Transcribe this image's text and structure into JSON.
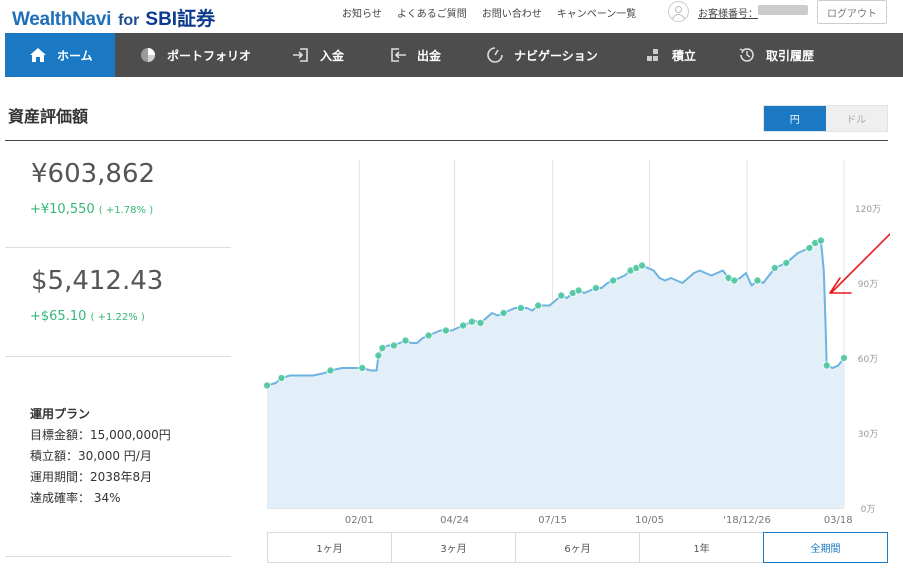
{
  "brand": {
    "name": "WealthNavi",
    "for": "for",
    "partner": "SBI証券"
  },
  "top_links": [
    "お知らせ",
    "よくあるご質問",
    "お問い合わせ",
    "キャンペーン一覧"
  ],
  "account_label": "お客様番号：",
  "logout_label": "ログアウト",
  "nav": [
    {
      "label": "ホーム",
      "icon": "home-icon",
      "active": true
    },
    {
      "label": "ポートフォリオ",
      "icon": "pie-chart-icon",
      "active": false
    },
    {
      "label": "入金",
      "icon": "deposit-icon",
      "active": false
    },
    {
      "label": "出金",
      "icon": "withdraw-icon",
      "active": false
    },
    {
      "label": "ナビゲーション",
      "icon": "gauge-icon",
      "active": false
    },
    {
      "label": "積立",
      "icon": "blocks-icon",
      "active": false
    },
    {
      "label": "取引履歴",
      "icon": "history-icon",
      "active": false
    }
  ],
  "section_title": "資産評価額",
  "currency_toggle": {
    "yen": "円",
    "dollar": "ドル",
    "selected": "円"
  },
  "jpy": {
    "value": "¥603,862",
    "change": "+¥10,550",
    "pct": "( +1.78% )"
  },
  "usd": {
    "value": "$5,412.43",
    "change": "+$65.10",
    "pct": "( +1.22% )"
  },
  "plan": {
    "title": "運用プラン",
    "target": "目標金額：15,000,000円",
    "monthly": "積立額：30,000 円/月",
    "term": "運用期間：2038年8月",
    "probability": "達成確率： 34%"
  },
  "periods": [
    "1ヶ月",
    "3ヶ月",
    "6ヶ月",
    "1年",
    "全期間"
  ],
  "active_period": "全期間",
  "chart_data": {
    "type": "area",
    "x_tick_labels": [
      "02/01",
      "04/24",
      "07/15",
      "10/05",
      "'18/12/26",
      "03/18"
    ],
    "y_tick_labels": [
      "0万",
      "30万",
      "60万",
      "90万",
      "120万"
    ],
    "ylim": [
      0,
      120
    ],
    "y_unit": "万円",
    "x_range": [
      0,
      100
    ],
    "x_ticks_pos": [
      16,
      32.5,
      49.5,
      66.3,
      83.2,
      99
    ],
    "series": [
      {
        "values": [
          [
            0,
            49
          ],
          [
            1.5,
            50
          ],
          [
            2.5,
            52
          ],
          [
            4,
            53
          ],
          [
            6,
            53
          ],
          [
            8,
            53
          ],
          [
            10,
            54
          ],
          [
            11,
            55
          ],
          [
            13,
            56
          ],
          [
            15,
            56
          ],
          [
            16.5,
            56
          ],
          [
            18,
            55
          ],
          [
            19,
            55
          ],
          [
            19.3,
            61
          ],
          [
            20,
            64
          ],
          [
            21,
            65
          ],
          [
            22,
            65
          ],
          [
            23,
            66
          ],
          [
            24,
            67
          ],
          [
            25,
            66
          ],
          [
            26,
            66
          ],
          [
            27,
            68
          ],
          [
            28,
            69
          ],
          [
            29,
            70
          ],
          [
            30,
            71
          ],
          [
            31,
            71
          ],
          [
            32,
            71
          ],
          [
            33,
            72
          ],
          [
            34,
            73
          ],
          [
            35,
            74
          ],
          [
            36,
            75
          ],
          [
            37,
            74
          ],
          [
            38,
            76
          ],
          [
            39,
            78
          ],
          [
            40,
            77
          ],
          [
            41,
            78
          ],
          [
            42,
            79
          ],
          [
            43,
            80
          ],
          [
            44,
            80
          ],
          [
            45,
            80
          ],
          [
            46,
            79
          ],
          [
            47,
            81
          ],
          [
            48,
            81
          ],
          [
            49,
            81
          ],
          [
            50,
            83
          ],
          [
            51,
            85
          ],
          [
            52,
            84
          ],
          [
            53,
            86
          ],
          [
            54,
            87
          ],
          [
            55,
            86
          ],
          [
            56,
            87
          ],
          [
            57,
            88
          ],
          [
            58,
            88
          ],
          [
            59,
            90
          ],
          [
            60,
            91
          ],
          [
            61,
            92
          ],
          [
            62,
            93
          ],
          [
            63,
            95
          ],
          [
            64,
            96
          ],
          [
            65,
            97
          ],
          [
            66,
            96
          ],
          [
            67,
            95
          ],
          [
            68,
            92
          ],
          [
            69,
            91
          ],
          [
            70,
            92
          ],
          [
            71,
            91
          ],
          [
            72,
            90
          ],
          [
            73,
            92
          ],
          [
            74,
            94
          ],
          [
            75,
            95
          ],
          [
            76,
            94
          ],
          [
            77,
            93
          ],
          [
            78,
            94
          ],
          [
            79,
            95
          ],
          [
            80,
            92
          ],
          [
            81,
            91
          ],
          [
            82,
            92
          ],
          [
            83,
            94
          ],
          [
            84,
            89
          ],
          [
            85,
            91
          ],
          [
            86,
            90
          ],
          [
            87,
            93
          ],
          [
            88,
            96
          ],
          [
            89,
            97
          ],
          [
            90,
            98
          ],
          [
            91,
            100
          ],
          [
            92,
            102
          ],
          [
            93,
            103
          ],
          [
            94,
            104
          ],
          [
            95,
            106
          ],
          [
            96,
            107
          ],
          [
            96.5,
            95
          ],
          [
            96.8,
            74
          ],
          [
            97,
            57
          ],
          [
            98,
            56
          ],
          [
            99,
            57
          ],
          [
            100,
            60
          ]
        ]
      }
    ],
    "markers_x": [
      0,
      2.5,
      11,
      16.5,
      19.3,
      20,
      22,
      24,
      28,
      31,
      34,
      35.5,
      37,
      41,
      44,
      47,
      51,
      53,
      54,
      57,
      60,
      63,
      64,
      65,
      80,
      81,
      85,
      88,
      90,
      94,
      95,
      96,
      97,
      100
    ],
    "annotation": "red-arrow",
    "colors": {
      "line": "#6db3e0",
      "fill": "#e2eff9",
      "marker": "#4fc9a0",
      "arrow": "#e8191e",
      "grid": "#e0e0e0"
    }
  }
}
